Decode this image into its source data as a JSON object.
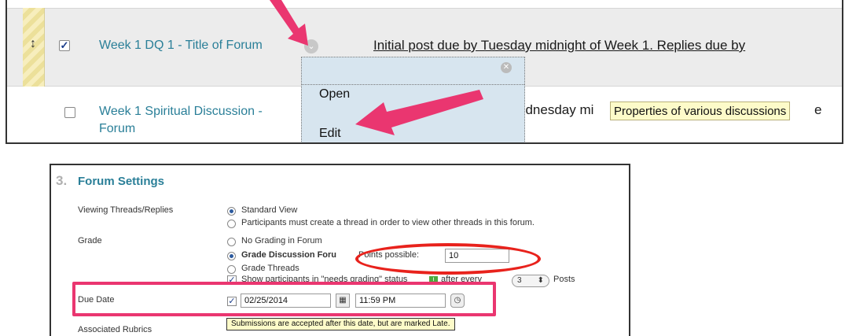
{
  "discussions": {
    "rows": [
      {
        "title": "Week 1 DQ 1 - Title of Forum",
        "checked": true,
        "description": "Initial post due by Tuesday midnight of Week 1. Replies due by"
      },
      {
        "title_line1": "Week 1 Spiritual Discussion - ",
        "title_line2": "Forum",
        "checked": false,
        "description_line1": "ednesday mi",
        "description_line1_tail": "e",
        "description_line2": "."
      }
    ],
    "context_menu": {
      "items": [
        "Open",
        "Edit"
      ]
    },
    "tooltip": "Properties of various discussions"
  },
  "forum_settings": {
    "step_number": "3.",
    "title": "Forum Settings",
    "viewing": {
      "label": "Viewing Threads/Replies",
      "options": [
        "Standard View",
        "Participants must create a thread in order to view other threads in this forum."
      ],
      "selected": "Standard View"
    },
    "grade": {
      "label": "Grade",
      "options": [
        "No Grading in Forum",
        "Grade Discussion Forum",
        "Grade Threads"
      ],
      "selected": "Grade Discussion Forum",
      "grade_forum_visible": "Grade Discussion Foru",
      "points_label": "Points possible:",
      "points_value": "10",
      "needs_grading_text": "Show participants in \"needs grading\" status",
      "after_every": "after every",
      "posts_count": "3",
      "posts_label": "Posts"
    },
    "due_date": {
      "label": "Due Date",
      "checked": true,
      "date": "02/25/2014",
      "time": "11:59 PM",
      "tooltip": "Submissions are accepted after this date, but are marked Late."
    },
    "rubrics": {
      "label": "Associated Rubrics"
    }
  },
  "colors": {
    "link": "#2a7f98",
    "annotation_pink": "#ea3670",
    "annotation_red": "#e8221c",
    "tooltip_bg": "#fdfbc9"
  }
}
